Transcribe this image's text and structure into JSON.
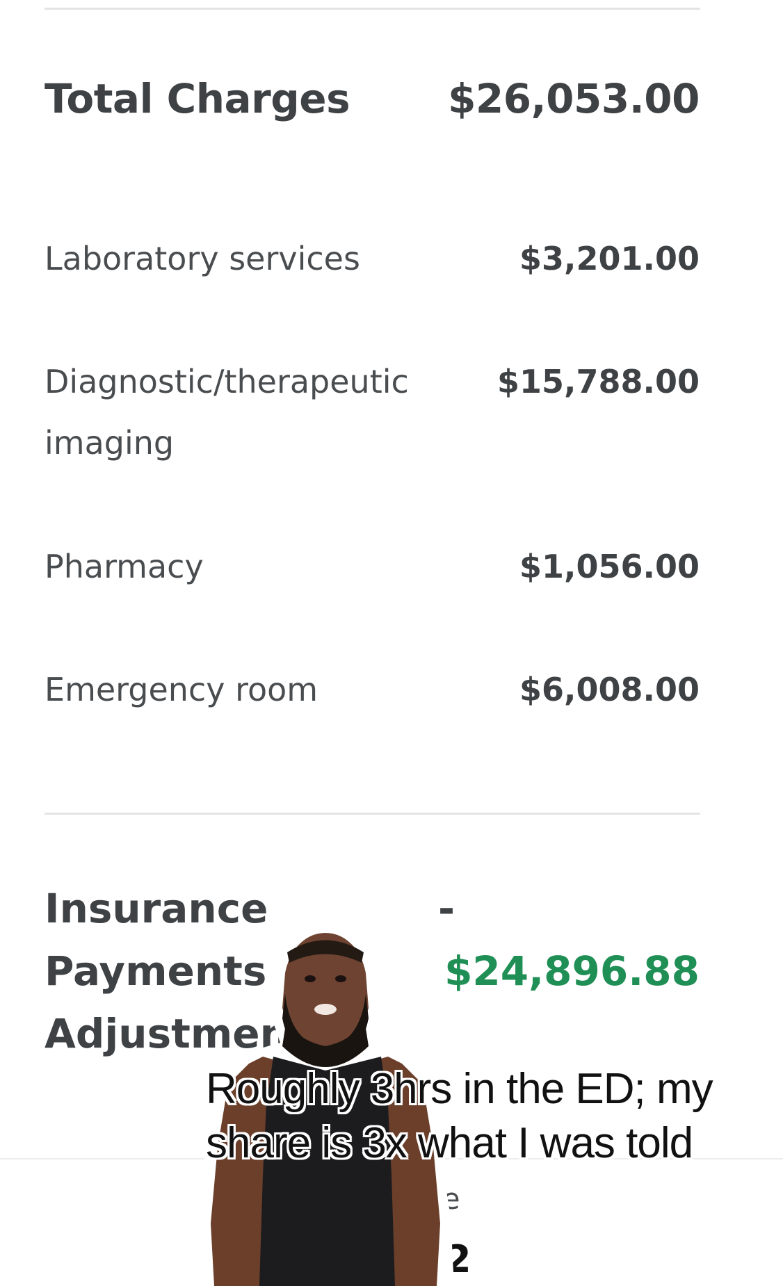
{
  "total": {
    "label": "Total Charges",
    "value": "$26,053.00"
  },
  "charges": [
    {
      "label": "Laboratory services",
      "value": "$3,201.00"
    },
    {
      "label": "Diagnostic/therapeutic imaging",
      "value": "$15,788.00"
    },
    {
      "label": "Pharmacy",
      "value": "$1,056.00"
    },
    {
      "label": "Emergency room",
      "value": "$6,008.00"
    }
  ],
  "insurance": {
    "label": "Insurance Payments and Adjustments",
    "sign": "-",
    "value": "$24,896.88",
    "value_color": "#1f8f55"
  },
  "partial": {
    "label_fragment": "D e",
    "value_fragment": "2"
  },
  "overlay": {
    "caption_line1": "Roughly 3hrs in the ED; my",
    "caption_line2": "share is 3x what I was told"
  }
}
